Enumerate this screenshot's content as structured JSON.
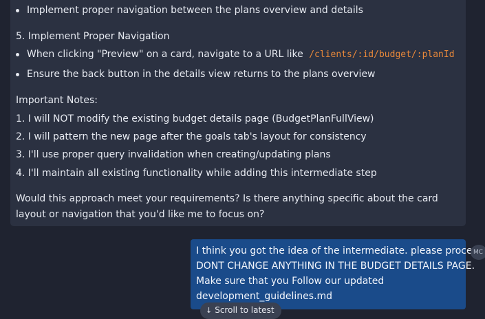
{
  "assistant": {
    "bullet_prev": "Implement proper navigation between the plans overview and details",
    "section5_heading": "5. Implement Proper Navigation",
    "bullet_preview_text": "When clicking \"Preview\" on a card, navigate to a URL like",
    "bullet_preview_code": "/clients/:id/budget/:planId",
    "bullet_back": "Ensure the back button in the details view returns to the plans overview",
    "notes_heading": "Important Notes:",
    "notes": [
      "1. I will NOT modify the existing budget details page (BudgetPlanFullView)",
      "2. I will pattern the new page after the goals tab's layout for consistency",
      "3. I'll use proper query invalidation when creating/updating plans",
      "4. I'll maintain all existing functionality while adding this intermediate step"
    ],
    "closing": "Would this approach meet your requirements? Is there anything specific about the card layout or navigation that you'd like me to focus on?"
  },
  "user": {
    "lines": [
      "I think you got the idea of the intermediate. please proceed.",
      "DONT CHANGE ANYTHING IN THE BUDGET DETAILS PAGE.",
      "Make sure that you Follow our updated",
      "development_guidelines.md"
    ],
    "avatar_initials": "MC"
  },
  "scroll_button": {
    "icon": "arrow-down-icon",
    "label": "Scroll to latest"
  },
  "colors": {
    "background": "#1f2330",
    "assistant_card": "#2b3141",
    "user_bubble": "#1a4b8a",
    "code_accent": "#e8883a"
  }
}
